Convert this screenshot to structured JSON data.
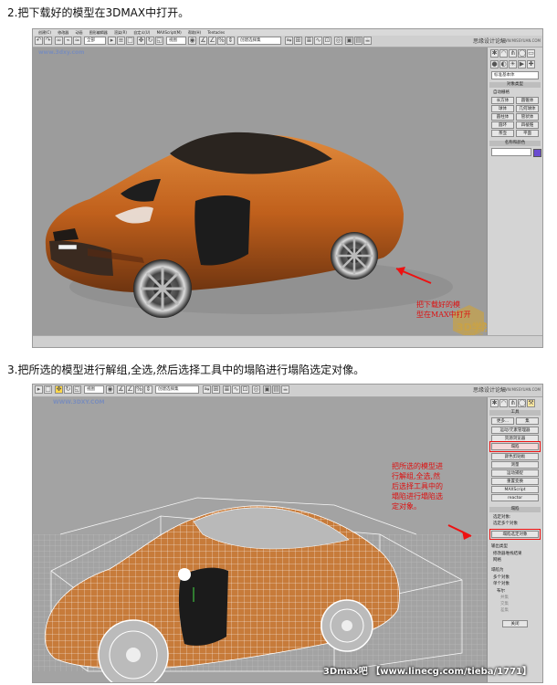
{
  "steps": {
    "step2": "2.把下载好的模型在3DMAX中打开。",
    "step3": "3.把所选的模型进行解组,全选,然后选择工具中的塌陷进行塌陷选定对像。"
  },
  "shot1": {
    "menu": [
      "创建(C)",
      "修改器",
      "动画",
      "图形编辑器",
      "渲染(R)",
      "自定义(U)",
      "MAXScript(M)",
      "帮助(H)",
      "Tentacles"
    ],
    "dd_select": "全部",
    "dd_view": "视图",
    "dd_named": "创建选择集",
    "forum": "思缘设计论坛",
    "site": "WWW.MISSYUAN.COM",
    "viewport_watermark": "www.3dxy.com",
    "panel": {
      "dropdown": "标准基本体",
      "section1": "对象类型",
      "autogrid": "自动栅格",
      "buttons": [
        [
          "长方体",
          "圆锥体"
        ],
        [
          "球体",
          "几何球体"
        ],
        [
          "圆柱体",
          "管状体"
        ],
        [
          "圆环",
          "四棱锥"
        ],
        [
          "茶壶",
          "平面"
        ]
      ],
      "section2": "名称和颜色"
    },
    "annotation": [
      "把下载好的模",
      "型在MAX中打开"
    ],
    "logo": "3D学院",
    "logo_site": "3DXY.COM"
  },
  "shot2": {
    "dd_view": "视图",
    "dd_named": "创建选择集",
    "forum": "思缘设计论坛",
    "site": "WWW.MISSYUAN.COM",
    "viewport_watermark": "WWW.3DXY.COM",
    "panel": {
      "section1": "工具",
      "top_buttons": [
        "更多...",
        "集"
      ],
      "buttons": [
        "运动/元素管理器",
        "资源浏览器",
        "塌陷",
        "颜色剪贴板",
        "测量",
        "运动捕捉",
        "重置变换",
        "MAXScript",
        "reactor"
      ],
      "section2": "塌陷",
      "selected_label": "选定对象:",
      "selected_value": "选定多个对象",
      "collapse_button": "塌陷选定对象",
      "output_label": "输出类型",
      "output_options": [
        "修改器堆栈结果",
        "网格"
      ],
      "collapse_to_label": "塌陷为",
      "collapse_to_options": [
        "多个对象",
        "单个对象"
      ],
      "boolean_label": "布尔",
      "boolean_options": [
        "并集",
        "交集",
        "差集"
      ],
      "close_button": "关闭"
    },
    "annotation": [
      "把所选的模型进",
      "行解组,全选,然",
      "后选择工具中的",
      "塌陷进行塌陷选",
      "定对象。"
    ],
    "footer_watermark": "3Dmax吧 【www.linecg.com/tieba/1771】"
  }
}
